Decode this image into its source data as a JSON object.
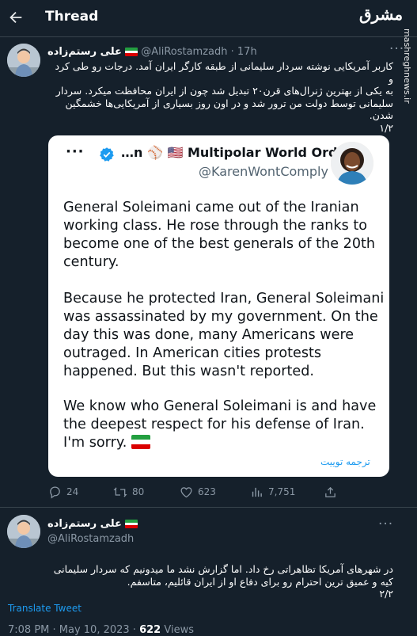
{
  "header": {
    "title": "Thread"
  },
  "watermark": {
    "logo": "مشرق",
    "url": "mashreghnews.ir"
  },
  "tweet1": {
    "author_name": "علی رستم‌زاده",
    "handle_time": "@AliRostamzadh · 17h",
    "text": [
      "کاربر آمریکایی نوشته سردار سلیمانی از طبقه کارگر ایران آمد. درجات رو طی کرد و",
      "به یکی از بهترین ژنرال‌های قرن۲۰ تبدیل شد چون از ایران محافظت میکرد. سردار",
      "سلیمانی توسط دولت من ترور شد و در اون روز بسیاری از آمریکایی‌ها خشمگین",
      "شدن.",
      "۱/۲"
    ]
  },
  "quote": {
    "display_name": "…n ⚾ 🇺🇸 Multipolar World Order",
    "handle": "@KarenWontComply",
    "paragraphs": [
      [
        "General Soleimani came out of the Iranian",
        "working class. He rose through the ranks to",
        "become one of the best generals of the 20th",
        "century."
      ],
      [
        "Because he protected Iran, General Soleimani",
        "was assassinated by my government. On the",
        "day this was done, many Americans were",
        "outraged. In American cities protests",
        "happened. But this wasn't reported."
      ],
      [
        "We know who General Soleimani is and have",
        "the deepest respect for his defense of Iran.",
        "I'm sorry."
      ]
    ],
    "translate": "ترجمه توییت"
  },
  "actions": {
    "replies": "24",
    "retweets": "80",
    "likes": "623",
    "views": "7,751"
  },
  "tweet2": {
    "author_name": "علی رستم‌زاده",
    "handle": "@AliRostamzadh",
    "text": [
      "در شهرهای آمریکا تظاهراتی رخ داد. اما گزارش نشد ما میدونیم که سردار سلیمانی",
      "کیه و عمیق ترین احترام رو برای دفاع او از ایران قائلیم، متاسفم.",
      "۲/۲"
    ],
    "translate": "Translate Tweet",
    "meta_time": "7:08 PM · May 10, 2023 · ",
    "meta_views_count": "622",
    "meta_views_label": " Views"
  },
  "colors": {
    "background": "#15202b",
    "accent": "#1d9bf0",
    "muted": "#8b98a5"
  }
}
